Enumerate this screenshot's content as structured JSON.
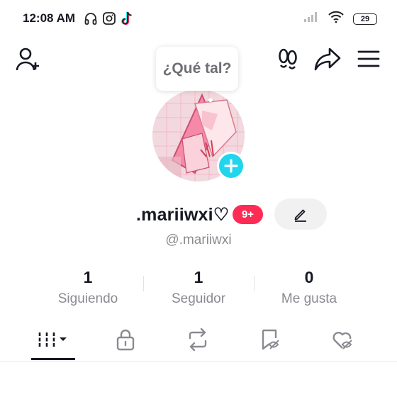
{
  "status_bar": {
    "time": "12:08 AM",
    "left_icons": [
      "headphones-icon",
      "instagram-icon",
      "tiktok-icon"
    ],
    "battery": "29"
  },
  "top_bar": {
    "left_icon": "add-friend-icon",
    "right_icons": [
      "footprints-icon",
      "share-icon",
      "menu-icon"
    ]
  },
  "bubble": {
    "text": "¿Qué tal?"
  },
  "profile": {
    "username": ".mariiwxi♡",
    "notification_badge": "9+",
    "handle": "@.mariiwxi"
  },
  "stats": [
    {
      "value": "1",
      "label": "Siguiendo"
    },
    {
      "value": "1",
      "label": "Seguidor"
    },
    {
      "value": "0",
      "label": "Me gusta"
    }
  ],
  "tabs": [
    {
      "icon": "grid-icon",
      "active": true
    },
    {
      "icon": "lock-icon",
      "active": false
    },
    {
      "icon": "repost-icon",
      "active": false
    },
    {
      "icon": "bookmark-hidden-icon",
      "active": false
    },
    {
      "icon": "heart-hidden-icon",
      "active": false
    }
  ],
  "colors": {
    "accent": "#fe2c55",
    "add_badge": "#20d5ec",
    "text": "#161823",
    "muted": "#8a8b91"
  }
}
